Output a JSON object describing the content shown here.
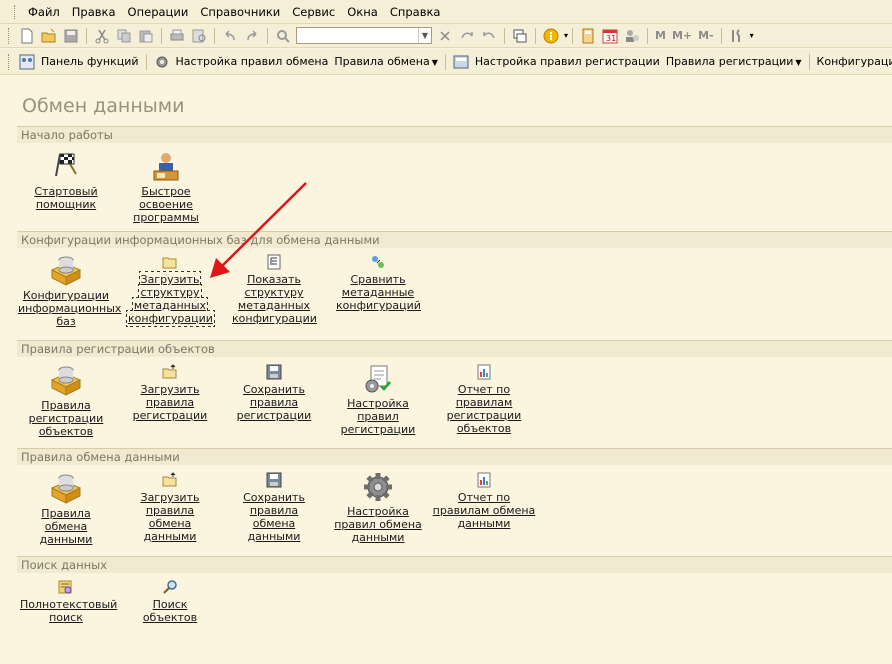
{
  "menu": [
    {
      "label": "Файл"
    },
    {
      "label": "Правка"
    },
    {
      "label": "Операции"
    },
    {
      "label": "Справочники"
    },
    {
      "label": "Сервис"
    },
    {
      "label": "Окна"
    },
    {
      "label": "Справка"
    }
  ],
  "toolbar2": {
    "panel_functions": "Панель функций",
    "exchange_rules_setup": "Настройка правил обмена",
    "exchange_rules": "Правила обмена",
    "registration_rules_setup": "Настройка правил регистрации",
    "registration_rules": "Правила регистрации",
    "configurations": "Конфигурации"
  },
  "toolbar1": {
    "m": "M",
    "mplus": "M+",
    "mminus": "M-"
  },
  "page": {
    "title": "Обмен данными"
  },
  "sections": [
    {
      "title": "Начало работы"
    },
    {
      "title": "Конфигурации информационных баз для обмена данными"
    },
    {
      "title": "Правила регистрации объектов"
    },
    {
      "title": "Правила обмена данными"
    },
    {
      "title": "Поиск данных"
    }
  ],
  "commands": {
    "start": [
      "Стартовый помощник",
      "Быстрое освоение программы"
    ],
    "configs": [
      "Конфигурации информационных баз",
      "Загрузить структуру метаданных конфигурации",
      "Показать структуру метаданных конфигурации",
      "Сравнить метаданные конфигураций"
    ],
    "registration": [
      "Правила регистрации объектов",
      "Загрузить правила регистрации",
      "Сохранить правила регистрации",
      "Настройка правил регистрации",
      "Отчет по правилам регистрации объектов"
    ],
    "exchange": [
      "Правила обмена данными",
      "Загрузить правила обмена данными",
      "Сохранить правила обмена данными",
      "Настройка правил обмена данными",
      "Отчет по правилам обмена данными"
    ],
    "search": [
      "Полнотекстовый поиск",
      "Поиск объектов"
    ]
  },
  "colors": {
    "background": "#FBF4DE",
    "section": "#F2EAD0",
    "arrow": "#E01515"
  }
}
